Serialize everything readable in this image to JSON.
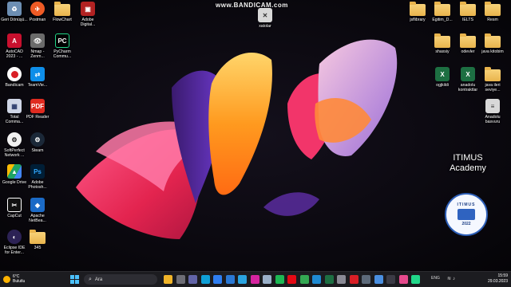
{
  "watermark": "www.BANDICAM.com",
  "desktop": {
    "left_column_1": [
      {
        "label": "Geri Dönüşü...",
        "icon": "recycle-bin-icon",
        "color": "#6d8fb3"
      },
      {
        "label": "AutoCAD 2023 - ...",
        "icon": "autocad-icon",
        "color": "#c8102e"
      },
      {
        "label": "Bandicam",
        "icon": "bandicam-icon",
        "color": "#d91f26"
      },
      {
        "label": "Total Comma...",
        "icon": "total-commander-icon",
        "color": "#cfd6e6"
      },
      {
        "label": "SoftPerfect Network ...",
        "icon": "softperfect-icon",
        "color": "#f2f2f2"
      },
      {
        "label": "Google Drive",
        "icon": "google-drive-icon",
        "color": "#1fa463"
      },
      {
        "label": "CapCut",
        "icon": "capcut-icon",
        "color": "#111111"
      },
      {
        "label": "Eclipse IDE for Enter...",
        "icon": "eclipse-icon",
        "color": "#2c2255"
      }
    ],
    "left_column_2": [
      {
        "label": "Postman",
        "icon": "postman-icon",
        "color": "#ef5b25"
      },
      {
        "label": "Nmap - Zenm...",
        "icon": "nmap-icon",
        "color": "#6b6b6b"
      },
      {
        "label": "TeamVie...",
        "icon": "teamviewer-icon",
        "color": "#0e8ee9"
      },
      {
        "label": "PDF Reader",
        "icon": "pdf-reader-icon",
        "color": "#e02b20"
      },
      {
        "label": "Steam",
        "icon": "steam-icon",
        "color": "#1b2838"
      },
      {
        "label": "Adobe Photosh...",
        "icon": "photoshop-icon",
        "color": "#001e36"
      },
      {
        "label": "Apache NetBea...",
        "icon": "netbeans-icon",
        "color": "#1b6ac6"
      },
      {
        "label": "345",
        "icon": "folder-icon",
        "color": "#e9b44c"
      }
    ],
    "left_column_3": [
      {
        "label": "FlowChart",
        "icon": "folder-icon",
        "color": "#e9b44c"
      },
      {
        "label": "PyCharm Commu...",
        "icon": "pycharm-icon",
        "color": "#21d789"
      }
    ],
    "left_column_4": [
      {
        "label": "Adobe Digital...",
        "icon": "adobe-digital-icon",
        "color": "#b22222"
      }
    ],
    "center": [
      {
        "label": "xatolar",
        "icon": "document-icon",
        "color": "#d8d8d8"
      }
    ],
    "right_icons": [
      {
        "label": "jsflibrary",
        "icon": "folder-icon",
        "color": "#e9b44c"
      },
      {
        "label": "Egitim_D...",
        "icon": "folder-icon",
        "color": "#e9b44c"
      },
      {
        "label": "IELTS",
        "icon": "folder-icon",
        "color": "#e9b44c"
      },
      {
        "label": "Resm",
        "icon": "folder-icon",
        "color": "#e9b44c"
      },
      {
        "label": "shaxsiy",
        "icon": "folder-icon",
        "color": "#e9b44c"
      },
      {
        "label": "odevler",
        "icon": "folder-icon",
        "color": "#e9b44c"
      },
      {
        "label": "java kitobim",
        "icon": "folder-icon",
        "color": "#e9b44c"
      },
      {
        "label": "ogjkildi",
        "icon": "excel-icon",
        "color": "#1d6f42"
      },
      {
        "label": "anadolu kontraktlar",
        "icon": "excel-icon",
        "color": "#1d6f42"
      },
      {
        "label": "java ileri seviye...",
        "icon": "folder-icon",
        "color": "#e9b44c"
      },
      {
        "label": "Anadolu basvuru",
        "icon": "document-icon",
        "color": "#d8d8d8"
      }
    ]
  },
  "overlay": {
    "title_line1": "ITIMUS",
    "title_line2": "Academy",
    "logo_ring": "ITIMUS",
    "logo_year": "2022"
  },
  "taskbar": {
    "temperature": "6°C",
    "weather": "Bulutlu",
    "search_placeholder": "Ara",
    "language": "ENG",
    "time": "15:59",
    "date": "29.03.2023",
    "apps": [
      {
        "icon": "file-explorer-icon",
        "color": "#f0b429"
      },
      {
        "icon": "task-view-icon",
        "color": "#6d6d75"
      },
      {
        "icon": "teams-icon",
        "color": "#6264a7"
      },
      {
        "icon": "edge-icon",
        "color": "#0f9fd6"
      },
      {
        "icon": "store-icon",
        "color": "#2f7ef0"
      },
      {
        "icon": "mail-icon",
        "color": "#2a78d4"
      },
      {
        "icon": "telegram-icon",
        "color": "#2aa4e0"
      },
      {
        "icon": "instagram-icon",
        "color": "#d6249f"
      },
      {
        "icon": "mouse-app-icon",
        "color": "#9ab0c8"
      },
      {
        "icon": "spotify-icon",
        "color": "#1db954"
      },
      {
        "icon": "netflix-icon",
        "color": "#e50914"
      },
      {
        "icon": "chrome-icon",
        "color": "#34a853"
      },
      {
        "icon": "vscode-icon",
        "color": "#1f8ad2"
      },
      {
        "icon": "excel-taskbar-icon",
        "color": "#1d6f42"
      },
      {
        "icon": "settings-icon",
        "color": "#8a8a95"
      },
      {
        "icon": "bandicam-taskbar-icon",
        "color": "#d91f26"
      },
      {
        "icon": "camera-icon",
        "color": "#5d6a7a"
      },
      {
        "icon": "photos-icon",
        "color": "#4a8fe0"
      },
      {
        "icon": "terminal-icon",
        "color": "#3b3b45"
      },
      {
        "icon": "intellij-icon",
        "color": "#e64a8d"
      },
      {
        "icon": "pycharm-taskbar-icon",
        "color": "#21d789"
      }
    ]
  }
}
